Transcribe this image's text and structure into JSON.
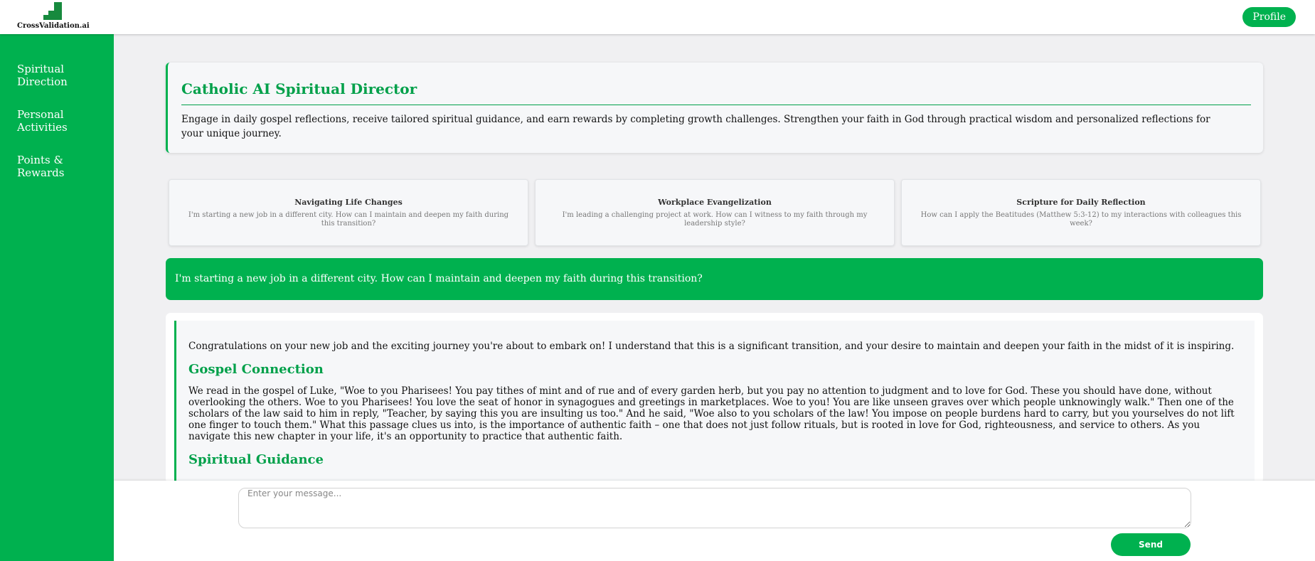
{
  "header": {
    "logo_text": "CrossValidation.ai",
    "profile_label": "Profile"
  },
  "sidebar": {
    "items": [
      {
        "label": "Spiritual Direction"
      },
      {
        "label": "Personal Activities"
      },
      {
        "label": "Points & Rewards"
      }
    ]
  },
  "intro": {
    "title": "Catholic AI Spiritual Director",
    "description": "Engage in daily gospel reflections, receive tailored spiritual guidance, and earn rewards by completing growth challenges. Strengthen your faith in God through practical wisdom and personalized reflections for your unique journey."
  },
  "suggestions": [
    {
      "title": "Navigating Life Changes",
      "text": "I'm starting a new job in a different city. How can I maintain and deepen my faith during this transition?"
    },
    {
      "title": "Workplace Evangelization",
      "text": "I'm leading a challenging project at work. How can I witness to my faith through my leadership style?"
    },
    {
      "title": "Scripture for Daily Reflection",
      "text": "How can I apply the Beatitudes (Matthew 5:3-12) to my interactions with colleagues this week?"
    }
  ],
  "chat": {
    "user_message": "I'm starting a new job in a different city. How can I maintain and deepen my faith during this transition?",
    "response": {
      "intro": "Congratulations on your new job and the exciting journey you're about to embark on! I understand that this is a significant transition, and your desire to maintain and deepen your faith in the midst of it is inspiring.",
      "gospel_heading": "Gospel Connection",
      "gospel_text": "We read in the gospel of Luke, \"Woe to you Pharisees! You pay tithes of mint and of rue and of every garden herb, but you pay no attention to judgment and to love for God. These you should have done, without overlooking the others. Woe to you Pharisees! You love the seat of honor in synagogues and greetings in marketplaces. Woe to you! You are like unseen graves over which people unknowingly walk.\" Then one of the scholars of the law said to him in reply, \"Teacher, by saying this you are insulting us too.\" And he said, \"Woe also to you scholars of the law! You impose on people burdens hard to carry, but you yourselves do not lift one finger to touch them.\" What this passage clues us into, is the importance of authentic faith – one that does not just follow rituals, but is rooted in love for God, righteousness, and service to others. As you navigate this new chapter in your life, it's an opportunity to practice that authentic faith.",
      "guidance_heading": "Spiritual Guidance"
    }
  },
  "composer": {
    "placeholder": "Enter your message...",
    "send_label": "Send"
  },
  "colors": {
    "brand_green": "#00b14f",
    "heading_green": "#00a04a",
    "logo_green": "#178a3e"
  }
}
